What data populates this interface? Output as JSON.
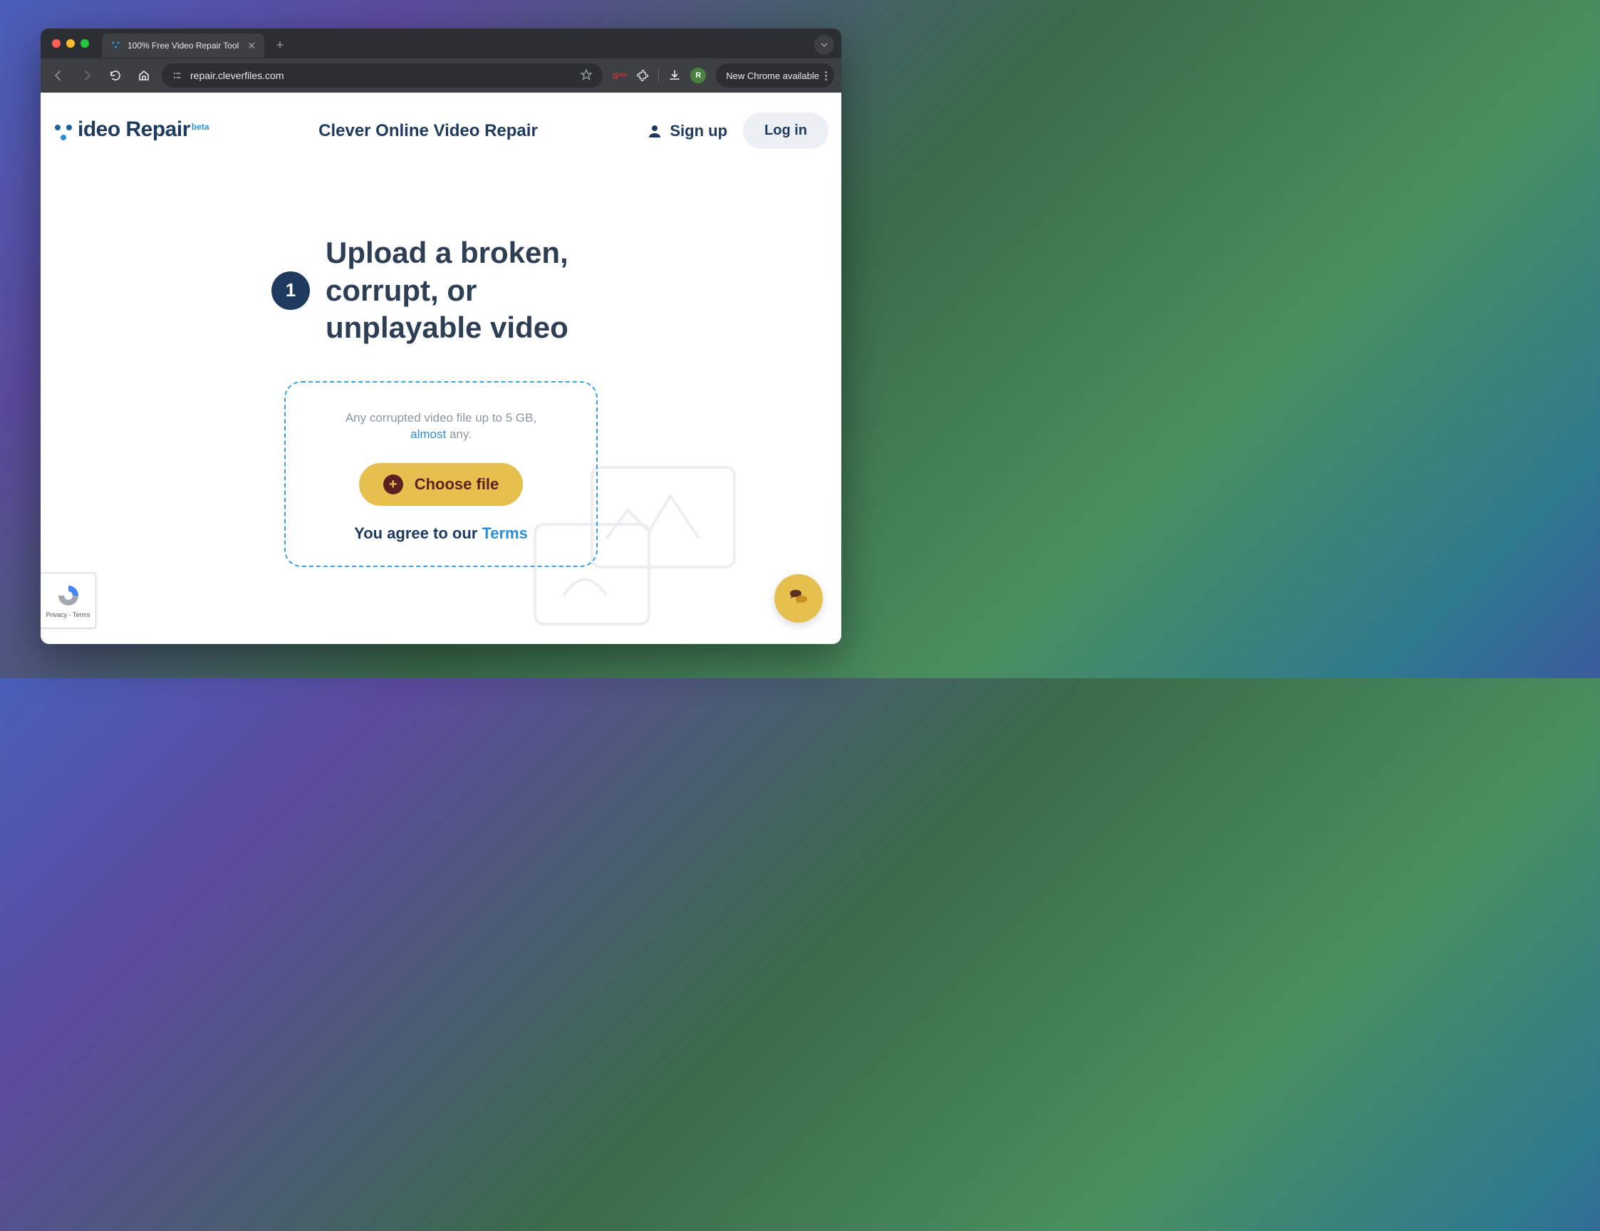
{
  "browser": {
    "tab_title": "100% Free Video Repair Tool",
    "url": "repair.cleverfiles.com",
    "update_label": "New Chrome available",
    "profile_initial": "R",
    "ext_seo_label": "SEO"
  },
  "header": {
    "logo_text": "ideo Repair",
    "logo_beta": "beta",
    "site_title": "Clever Online Video Repair",
    "signup": "Sign up",
    "login": "Log in"
  },
  "step": {
    "number": "1",
    "title": "Upload a broken, corrupt, or unplayable video"
  },
  "upload": {
    "desc_line1": "Any corrupted video file up to 5 GB,",
    "almost": "almost",
    "desc_line2_suffix": " any.",
    "choose_file": "Choose file",
    "agree_prefix": "You agree to our ",
    "terms": "Terms"
  },
  "recaptcha": {
    "line1": "Privacy",
    "sep": " - ",
    "line2": "Terms"
  }
}
